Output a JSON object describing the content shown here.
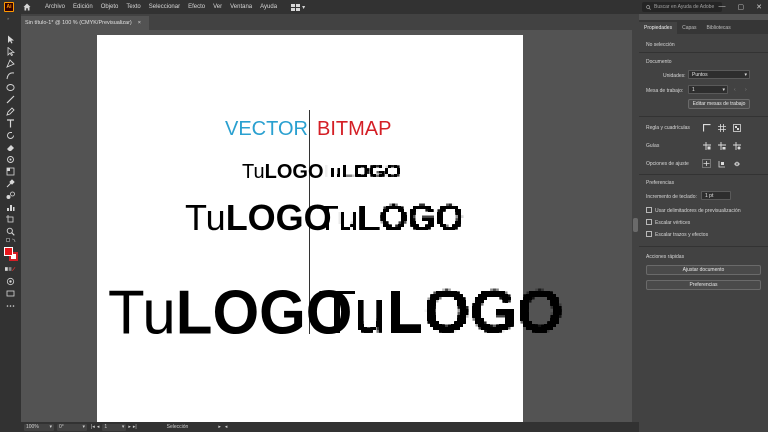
{
  "menubar": {
    "app_badge": "Ai",
    "items": [
      "Archivo",
      "Edición",
      "Objeto",
      "Texto",
      "Seleccionar",
      "Efecto",
      "Ver",
      "Ventana",
      "Ayuda"
    ],
    "search_placeholder": "Buscar en Ayuda de Adobe"
  },
  "document_tab": {
    "title": "Sin título-1* @ 100 % (CMYK/Previsualizar)",
    "close": "×"
  },
  "artboard": {
    "vector_heading": "VECTOR",
    "bitmap_heading": "BITMAP",
    "logo_tu": "Tu",
    "logo_word": "LOGO",
    "colors": {
      "vector": "#2aa0d0",
      "bitmap": "#d41f26"
    }
  },
  "statusbar": {
    "zoom": "100%",
    "angle": "0°",
    "artboard_num": "1",
    "tool_name": "Selección"
  },
  "panel": {
    "tabs": [
      "Propiedades",
      "Capas",
      "Bibliotecas"
    ],
    "no_selection": "No selección",
    "document_header": "Documento",
    "units_label": "Unidades:",
    "units_value": "Puntos",
    "artboard_label": "Mesa de trabajo:",
    "artboard_value": "1",
    "edit_artboards": "Editar mesas de trabajo",
    "rulers_grids": "Regla y cuadrículas",
    "guides": "Guías",
    "snap_options": "Opciones de ajuste",
    "preferences_header": "Preferencias",
    "keyboard_increment_label": "Incremento de teclado:",
    "keyboard_increment_value": "1 pt",
    "checkboxes": [
      "Usar delimitadores de previsualización",
      "Escalar vértices",
      "Escalar trazos y efectos"
    ],
    "quick_actions": "Acciones rápidas",
    "fit_document": "Ajustar documento",
    "preferences_button": "Preferencias"
  }
}
